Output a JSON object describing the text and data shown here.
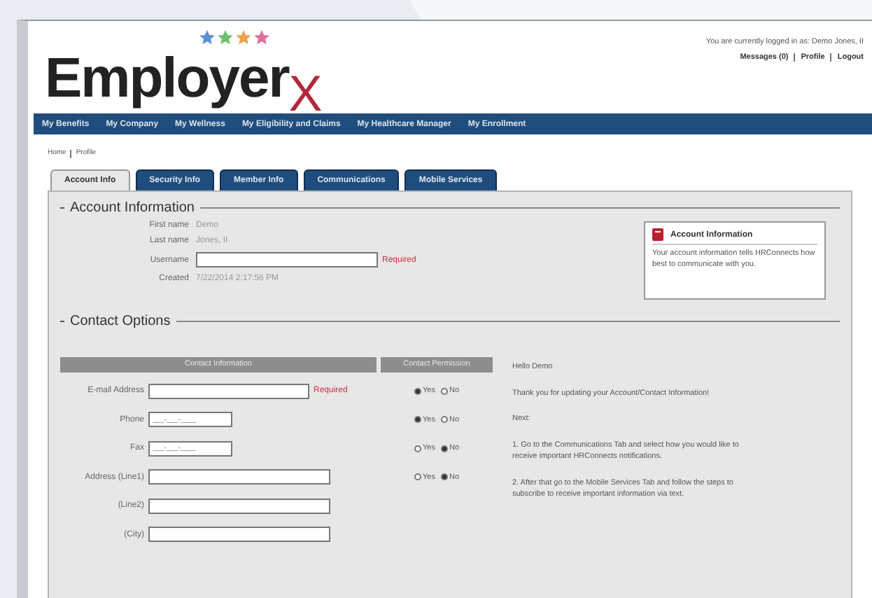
{
  "header": {
    "logo": {
      "word": "Employer",
      "mark": "X",
      "stars": [
        {
          "color": "#5b8fd6"
        },
        {
          "color": "#6cc070"
        },
        {
          "color": "#f0a050"
        },
        {
          "color": "#e0709a"
        }
      ]
    },
    "login_text": "You are currently logged in as: Demo Jones, II",
    "links": [
      {
        "label": "Messages (0)"
      },
      {
        "label": "Profile"
      },
      {
        "label": "Logout"
      }
    ]
  },
  "nav": [
    "My Benefits",
    "My Company",
    "My Wellness",
    "My Eligibility and Claims",
    "My Healthcare Manager",
    "My Enrollment"
  ],
  "breadcrumb": [
    "Home",
    "Profile"
  ],
  "tabs": [
    {
      "label": "Account Info",
      "selected": true
    },
    {
      "label": "Security Info",
      "selected": false
    },
    {
      "label": "Member Info",
      "selected": false
    },
    {
      "label": "Communications",
      "selected": false
    },
    {
      "label": "Mobile Services",
      "selected": false
    }
  ],
  "account": {
    "title": "Account Information",
    "rows": [
      {
        "kind": "text",
        "label": "First name",
        "value": "Demo"
      },
      {
        "kind": "text",
        "label": "Last name",
        "value": "Jones, II"
      },
      {
        "kind": "input",
        "label": "Username",
        "note": "Required"
      },
      {
        "kind": "text",
        "label": "Created",
        "value": "7/22/2014 2:17:56 PM"
      }
    ],
    "info": {
      "title": "Account Information",
      "text": "Your account information tells HRConnects how best to communicate with you."
    }
  },
  "contact": {
    "title": "Contact Options",
    "columns": [
      "Contact Information",
      "Contact Permission"
    ],
    "rows": [
      {
        "label": "E-mail Address",
        "note": "Required",
        "options": [
          {
            "label": "Yes",
            "selected": true
          },
          {
            "label": "No",
            "selected": false
          }
        ]
      },
      {
        "label": "Phone",
        "placeholder": "___-___-____",
        "options": [
          {
            "label": "Yes",
            "selected": true
          },
          {
            "label": "No",
            "selected": false
          }
        ]
      },
      {
        "label": "Fax",
        "placeholder": "___-___-____",
        "options": [
          {
            "label": "Yes",
            "selected": false
          },
          {
            "label": "No",
            "selected": true
          }
        ]
      },
      {
        "label": "Address (Line1)",
        "options": [
          {
            "label": "Yes",
            "selected": false
          },
          {
            "label": "No",
            "selected": true
          }
        ]
      },
      {
        "label": "(Line2)"
      },
      {
        "label": "(City)"
      }
    ],
    "message": [
      "Hello Demo",
      "Thank you for updating your Account/Contact Information!",
      "Next:",
      "1. Go to the Communications Tab and select how you would like to receive important HRConnects notifications.",
      "2. After that go to the Mobile Services Tab and follow the steps to subscribe to receive important information via text."
    ]
  }
}
